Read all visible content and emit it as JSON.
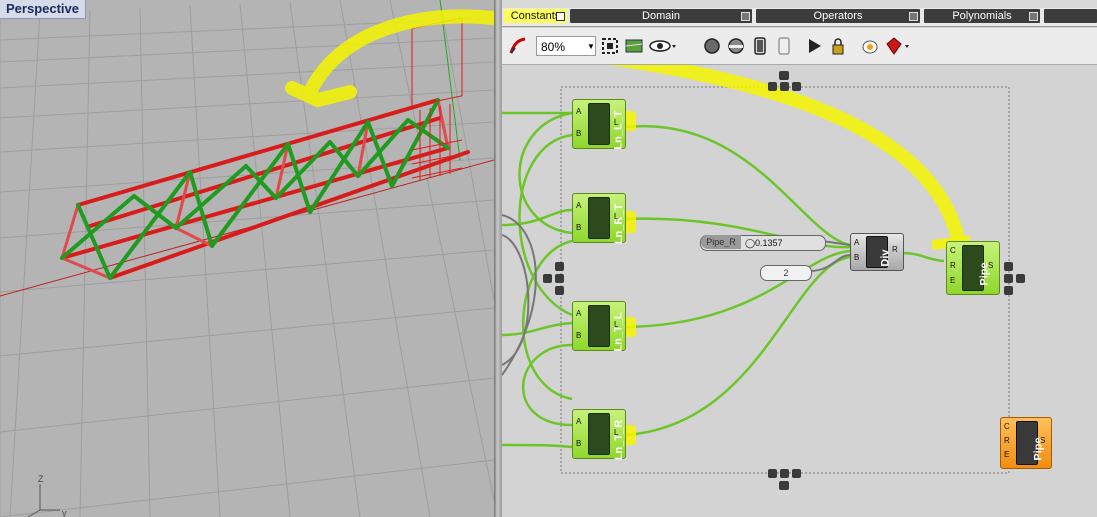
{
  "viewport": {
    "label": "Perspective",
    "axis": {
      "z": "Z",
      "y": "y"
    }
  },
  "ribbon": {
    "groups": [
      {
        "label": "Constants",
        "selected": true
      },
      {
        "label": "Domain",
        "selected": false
      },
      {
        "label": "Operators",
        "selected": false
      },
      {
        "label": "Polynomials",
        "selected": false
      }
    ]
  },
  "toolbar": {
    "zoom": "80%"
  },
  "canvas": {
    "components": [
      {
        "id": "ln_l_t",
        "label": "Ln_L_T",
        "inputs": [
          "A",
          "B"
        ],
        "outputs": [
          "L"
        ]
      },
      {
        "id": "ln_r_t",
        "label": "Ln_R_T",
        "inputs": [
          "A",
          "B"
        ],
        "outputs": [
          "L"
        ]
      },
      {
        "id": "ln_t_l",
        "label": "Ln_T_L",
        "inputs": [
          "A",
          "B"
        ],
        "outputs": [
          "L"
        ]
      },
      {
        "id": "ln_t_r",
        "label": "Ln_T_R",
        "inputs": [
          "A",
          "B"
        ],
        "outputs": [
          "L"
        ]
      },
      {
        "id": "div",
        "label": "Div",
        "inputs": [
          "A",
          "B"
        ],
        "outputs": [
          "R"
        ]
      },
      {
        "id": "pipe_a",
        "label": "Pipe",
        "inputs": [
          "C",
          "R",
          "E"
        ],
        "outputs": [
          "S"
        ]
      },
      {
        "id": "pipe_b",
        "label": "Pipe",
        "inputs": [
          "C",
          "R",
          "E"
        ],
        "outputs": [
          "S"
        ]
      }
    ],
    "slider": {
      "name": "Pipe_R",
      "value": "0.1357"
    },
    "panel_value": "2"
  },
  "colors": {
    "viewport_bg": "#b4b4b4",
    "canvas_bg": "#d3d3d3",
    "component_green": "#9be23c",
    "component_orange": "#f7a021",
    "wire_green": "#6cc62a",
    "highlight_yellow": "#f5f500",
    "truss_red": "#d81c1c",
    "truss_green": "#1f9b1f"
  }
}
